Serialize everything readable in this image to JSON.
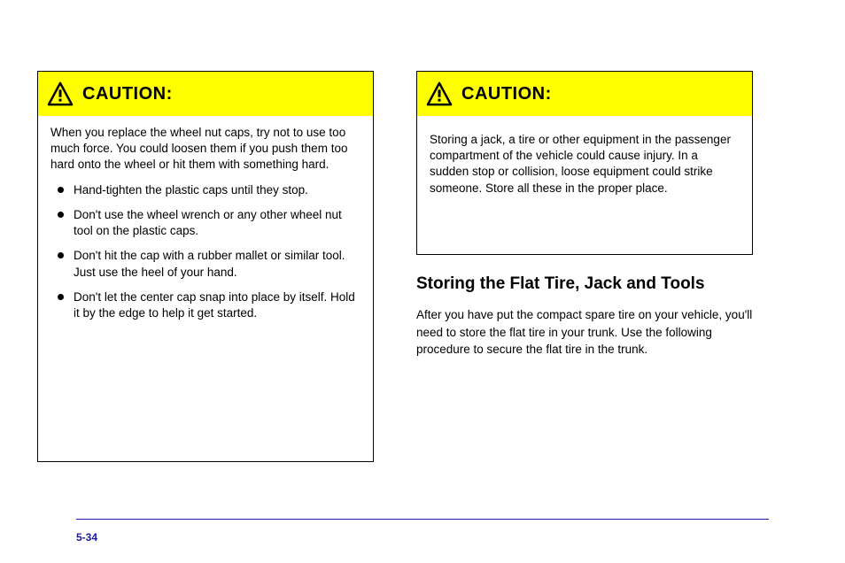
{
  "leftBox": {
    "label": "CAUTION:",
    "intro": "When you replace the wheel nut caps, try not to use too much force. You could loosen them if you push them too hard onto the wheel or hit them with something hard.",
    "items": [
      "Hand-tighten the plastic caps until they stop.",
      "Don't use the wheel wrench or any other wheel nut tool on the plastic caps.",
      "Don't hit the cap with a rubber mallet or similar tool. Just use the heel of your hand.",
      "Don't let the center cap snap into place by itself. Hold it by the edge to help it get started."
    ]
  },
  "rightBox": {
    "label": "CAUTION:",
    "body": "Storing a jack, a tire or other equipment in the passenger compartment of the vehicle could cause injury. In a sudden stop or collision, loose equipment could strike someone. Store all these in the proper place."
  },
  "section": {
    "heading": "Storing the Flat Tire, Jack and Tools",
    "paragraph": "After you have put the compact spare tire on your vehicle, you'll need to store the flat tire in your trunk. Use the following procedure to secure the flat tire in the trunk."
  },
  "footer": {
    "pageNum": "5-34"
  }
}
